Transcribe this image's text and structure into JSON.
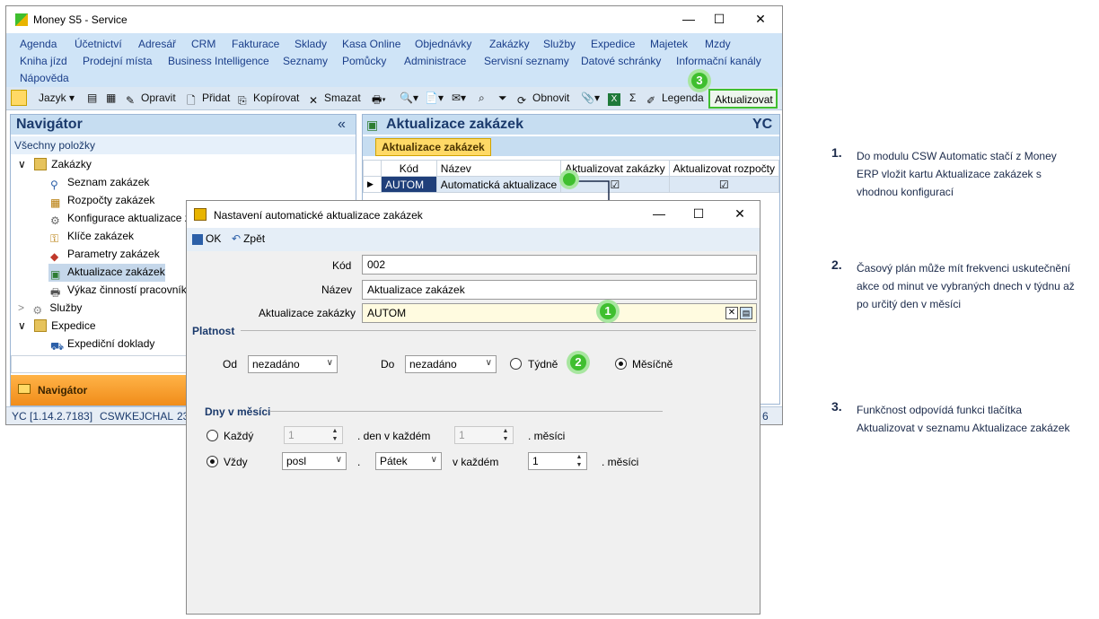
{
  "window": {
    "title": "Money S5 - Service",
    "controls": {
      "minimize": "—",
      "maximize": "☐",
      "close": "✕"
    }
  },
  "menu": {
    "row1": [
      "Agenda",
      "Účetnictví",
      "Adresář",
      "CRM",
      "Fakturace",
      "Sklady",
      "Kasa Online",
      "Objednávky",
      "Zakázky",
      "Služby",
      "Expedice",
      "Majetek",
      "Mzdy"
    ],
    "row2": [
      "Kniha jízd",
      "Prodejní místa",
      "Business Intelligence",
      "Seznamy",
      "Pomůcky",
      "Administrace",
      "Servisní seznamy",
      "Datové schránky",
      "Informační kanály"
    ],
    "row3": [
      "Nápověda"
    ]
  },
  "toolbar": {
    "jazyk": "Jazyk",
    "opravit": "Opravit",
    "pridat": "Přidat",
    "kopirovat": "Kopírovat",
    "smazat": "Smazat",
    "obnovit": "Obnovit",
    "legenda": "Legenda",
    "aktualizovat": "Aktualizovat",
    "sigma": "Σ"
  },
  "navigator": {
    "title": "Navigátor",
    "collapse": "«",
    "subtitle": "Všechny položky",
    "tree": [
      {
        "label": "Zakázky",
        "icon": "folder-icon",
        "level": 0,
        "expander": "∨"
      },
      {
        "label": "Seznam zakázek",
        "icon": "list-icon",
        "level": 1
      },
      {
        "label": "Rozpočty zakázek",
        "icon": "budget-icon",
        "level": 1
      },
      {
        "label": "Konfigurace aktualizace z",
        "icon": "gear-icon",
        "level": 1
      },
      {
        "label": "Klíče zakázek",
        "icon": "key-icon",
        "level": 1
      },
      {
        "label": "Parametry zakázek",
        "icon": "parameters-icon",
        "level": 1
      },
      {
        "label": "Aktualizace zakázek",
        "icon": "update-icon",
        "level": 1,
        "selected": true
      },
      {
        "label": "Výkaz činností pracovníků",
        "icon": "report-icon",
        "level": 1
      },
      {
        "label": "Služby",
        "icon": "services-icon",
        "level": 0,
        "expander": ">"
      },
      {
        "label": "Expedice",
        "icon": "folder-icon",
        "level": 0,
        "expander": "∨"
      },
      {
        "label": "Expediční doklady",
        "icon": "shipping-icon",
        "level": 1
      }
    ],
    "footer": "Navigátor"
  },
  "status": {
    "version": "YC [1.14.2.7183]",
    "server": "CSWKEJCHAL",
    "partial": "23",
    "right": "6"
  },
  "panel": {
    "title": "Aktualizace zakázek",
    "code": "YC",
    "tab": "Aktualizace zakázek",
    "columns": [
      "Kód",
      "Název",
      "Aktualizovat zakázky",
      "Aktualizovat rozpočty"
    ],
    "rows": [
      {
        "kod": "AUTOM",
        "nazev": "Automatická aktualizace",
        "zakazky": true,
        "rozpocty": true
      }
    ]
  },
  "dialog": {
    "title": "Nastavení automatické aktualizace zakázek",
    "ok": "OK",
    "back": "Zpět",
    "fields": {
      "kod_label": "Kód",
      "kod": "002",
      "nazev_label": "Název",
      "nazev": "Aktualizace zakázek",
      "aktualizace_label": "Aktualizace zakázky",
      "aktualizace": "AUTOM"
    },
    "platnost": {
      "title": "Platnost",
      "od_label": "Od",
      "od": "nezadáno",
      "do_label": "Do",
      "do": "nezadáno",
      "tydne": "Týdně",
      "mesicne": "Měsíčně"
    },
    "dny": {
      "title": "Dny v měsíci",
      "kazdy": "Každý",
      "kazdy_den": "1",
      "den_v_kazdem": ". den v každém",
      "kazdy_mesic": "1",
      "mesici": ". měsíci",
      "vzdy": "Vždy",
      "vzdy_order": "posl",
      "dot": ".",
      "vzdy_day": "Pátek",
      "v_kazdem": "v každém",
      "vzdy_mesic": "1",
      "mesici2": ". měsíci"
    }
  },
  "markers": [
    "1",
    "2",
    "3"
  ],
  "notes": [
    {
      "num": "1.",
      "text": "Do modulu CSW Automatic stačí z Money ERP vložit kartu Aktualizace zakázek s vhodnou konfigurací"
    },
    {
      "num": "2.",
      "text": "Časový plán může mít frekvenci uskutečnění akce od minut ve vybraných dnech v týdnu až po určitý den v měsíci"
    },
    {
      "num": "3.",
      "text": "Funkčnost odpovídá funkci tlačítka Aktualizovat v seznamu Aktualizace zakázek"
    }
  ],
  "colors": {
    "accent": "#3fbf2f",
    "menu_bg": "#cfe4f7",
    "tab": "#ffd966",
    "navigator_footer": "#f08c1a"
  }
}
